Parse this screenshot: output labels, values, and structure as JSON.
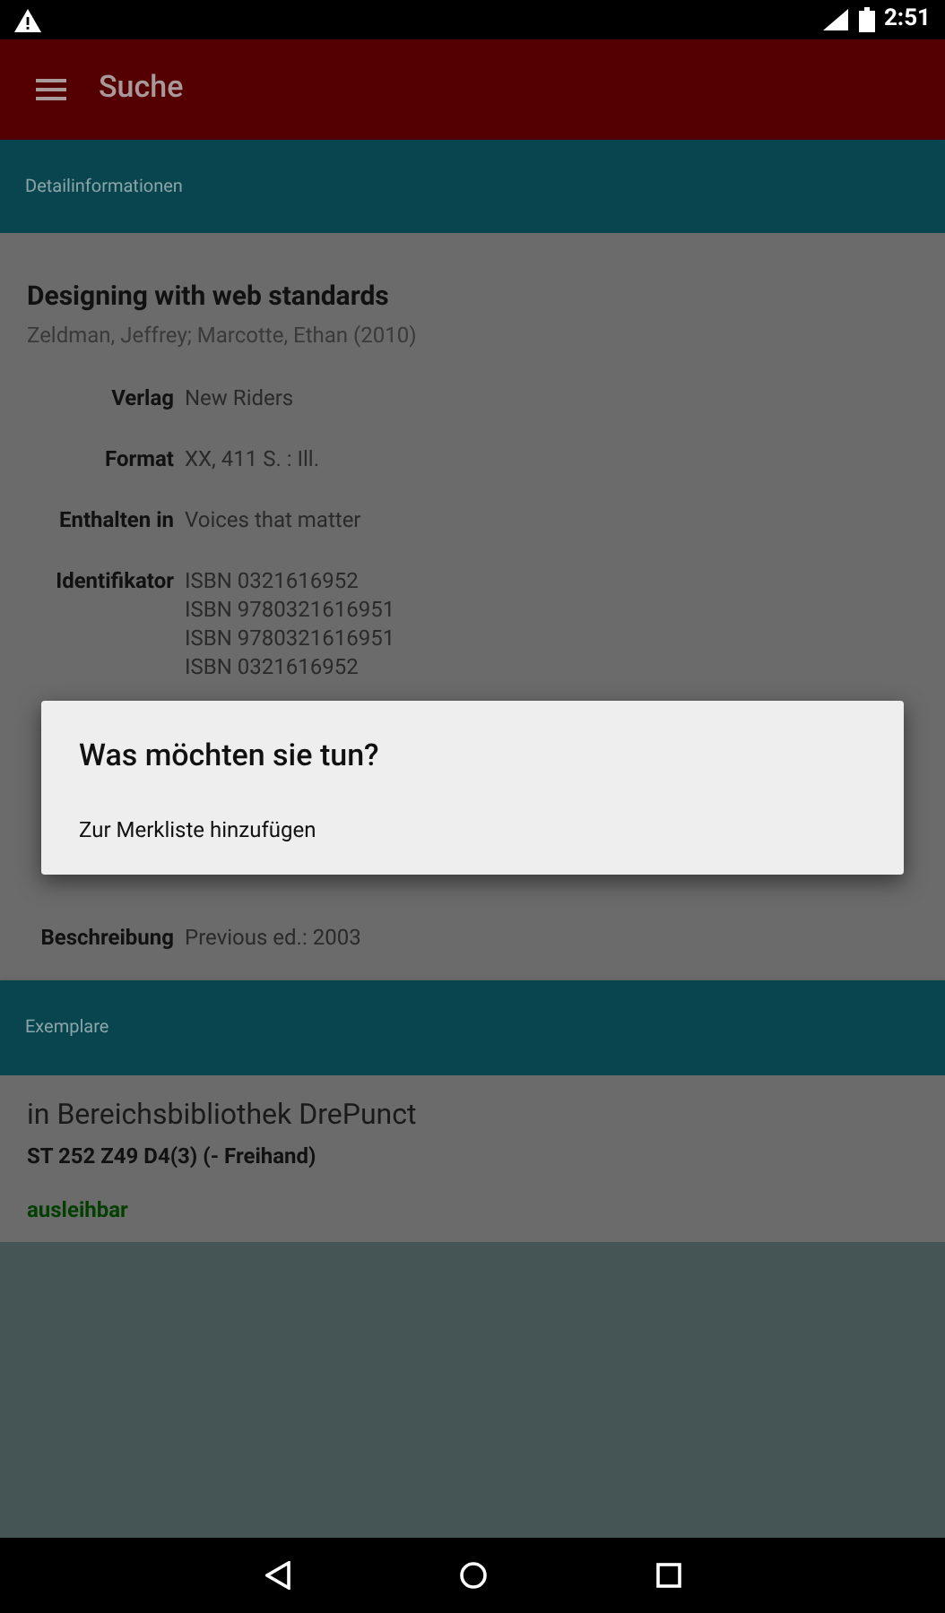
{
  "status_bar": {
    "time": "2:51"
  },
  "app_bar": {
    "title": "Suche"
  },
  "details_section": {
    "header": "Detailinformationen",
    "title": "Designing with web standards",
    "authors": "Zeldman, Jeffrey; Marcotte, Ethan (2010)",
    "fields": [
      {
        "label": "Verlag",
        "values": [
          "New Riders"
        ]
      },
      {
        "label": "Format",
        "values": [
          "XX, 411 S. : Ill."
        ]
      },
      {
        "label": "Enthalten in",
        "values": [
          "Voices that matter"
        ]
      },
      {
        "label": "Identifikator",
        "values": [
          "ISBN 0321616952",
          "ISBN 9780321616951",
          "ISBN 9780321616951",
          "ISBN 0321616952"
        ]
      },
      {
        "label": "Beschreibung",
        "values": [
          "Previous ed.: 2003"
        ]
      }
    ]
  },
  "copies_section": {
    "header": "Exemplare",
    "items": [
      {
        "library": "in Bereichsbibliothek DrePunct",
        "shelfmark": "ST 252 Z49 D4(3) (- Freihand)",
        "status": "ausleihbar",
        "color": "#003f00"
      }
    ]
  },
  "dialog": {
    "title": "Was möchten sie tun?",
    "options": [
      "Zur Merkliste hinzufügen"
    ]
  }
}
